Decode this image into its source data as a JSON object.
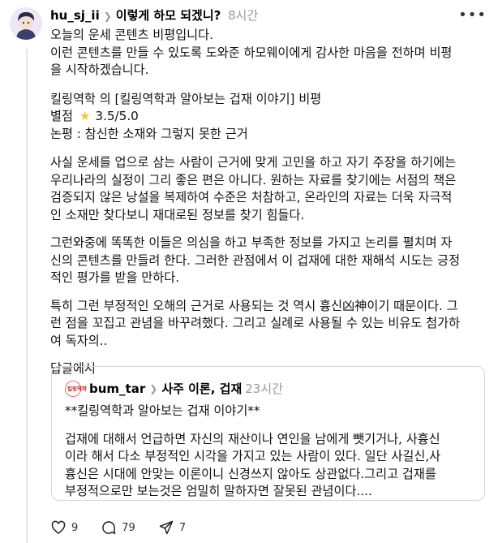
{
  "post": {
    "username": "hu_sj_ii",
    "topic": "이렇게 하모 되겠니?",
    "time": "8시간",
    "intro_line1": "오늘의 운세 콘텐츠 비평입니다.",
    "intro_line2": "이런 콘텐츠를 만들 수 있도록 도와준 하모웨이에게 감사한 마음을 전하며 비평\n을 시작하겠습니다.",
    "review_title": "킬링역학 의 [킬링역학과 알아보는 겁재 이야기] 비평",
    "rating_label": "별점",
    "rating_value": "3.5/5.0",
    "summary": "논평 : 참신한 소재와 그렇지 못한 근거",
    "p1": "사실 운세를 업으로 삼는 사람이 근거에 맞게 고민을 하고 자기 주장을 하기에는\n우리나라의 실정이 그리 좋은 편은 아니다. 원하는 자료를 찾기에는 서점의 책은\n검증되지 않은 낭설을 복제하여 수준은 처참하고, 온라인의 자료는 더욱 자극적\n인 소재만 찾다보니 재대로된 정보를 찾기 힘들다.",
    "p2": "그런와중에 똑똑한 이들은 의심을 하고 부족한 정보를 가지고 논리를 펼치며 자\n신의 콘텐츠를 만들려 한다. 그러한 관점에서 이 겁재에 대한 재해석 시도는 긍정\n적인 평가를 받을 만하다.",
    "p3": "특히 그런 부정적인 오해의 근거로 사용되는 것 역시 흉신凶神이기 때문이다. 그\n런 점을 꼬집고 관념을 바꾸려했다. 그리고 실례로 사용될 수 있는 비유도 첨가하\n여 독자의..",
    "reply_label": "답글에서"
  },
  "quote": {
    "avatar_text": "킬링역학",
    "username": "bum_tar",
    "topic": "사주 이론, 겁재",
    "time": "23시간",
    "title": "**킬링역학과 알아보는 겁재 이야기**",
    "body": "겁재에 대해서 언급하면 자신의 재산이나 연인을 남에게 뺏기거나, 사흉신\n이라 해서 다소 부정적인 시각을 가지고 있는 사람이 있다. 일단 사길신,사\n흉신은 시대에 안맞는 이론이니 신경쓰지 않아도 상관없다.그리고 겁재를\n부정적으로만 보는것은 엄밀히 말하자면 잘못된 관념이다...."
  },
  "actions": {
    "like_count": "9",
    "comment_count": "79",
    "share_count": "7"
  },
  "icons": [
    "avatar",
    "chevron-right-icon",
    "more-icon",
    "star-icon",
    "heart-icon",
    "comment-icon",
    "send-icon"
  ]
}
